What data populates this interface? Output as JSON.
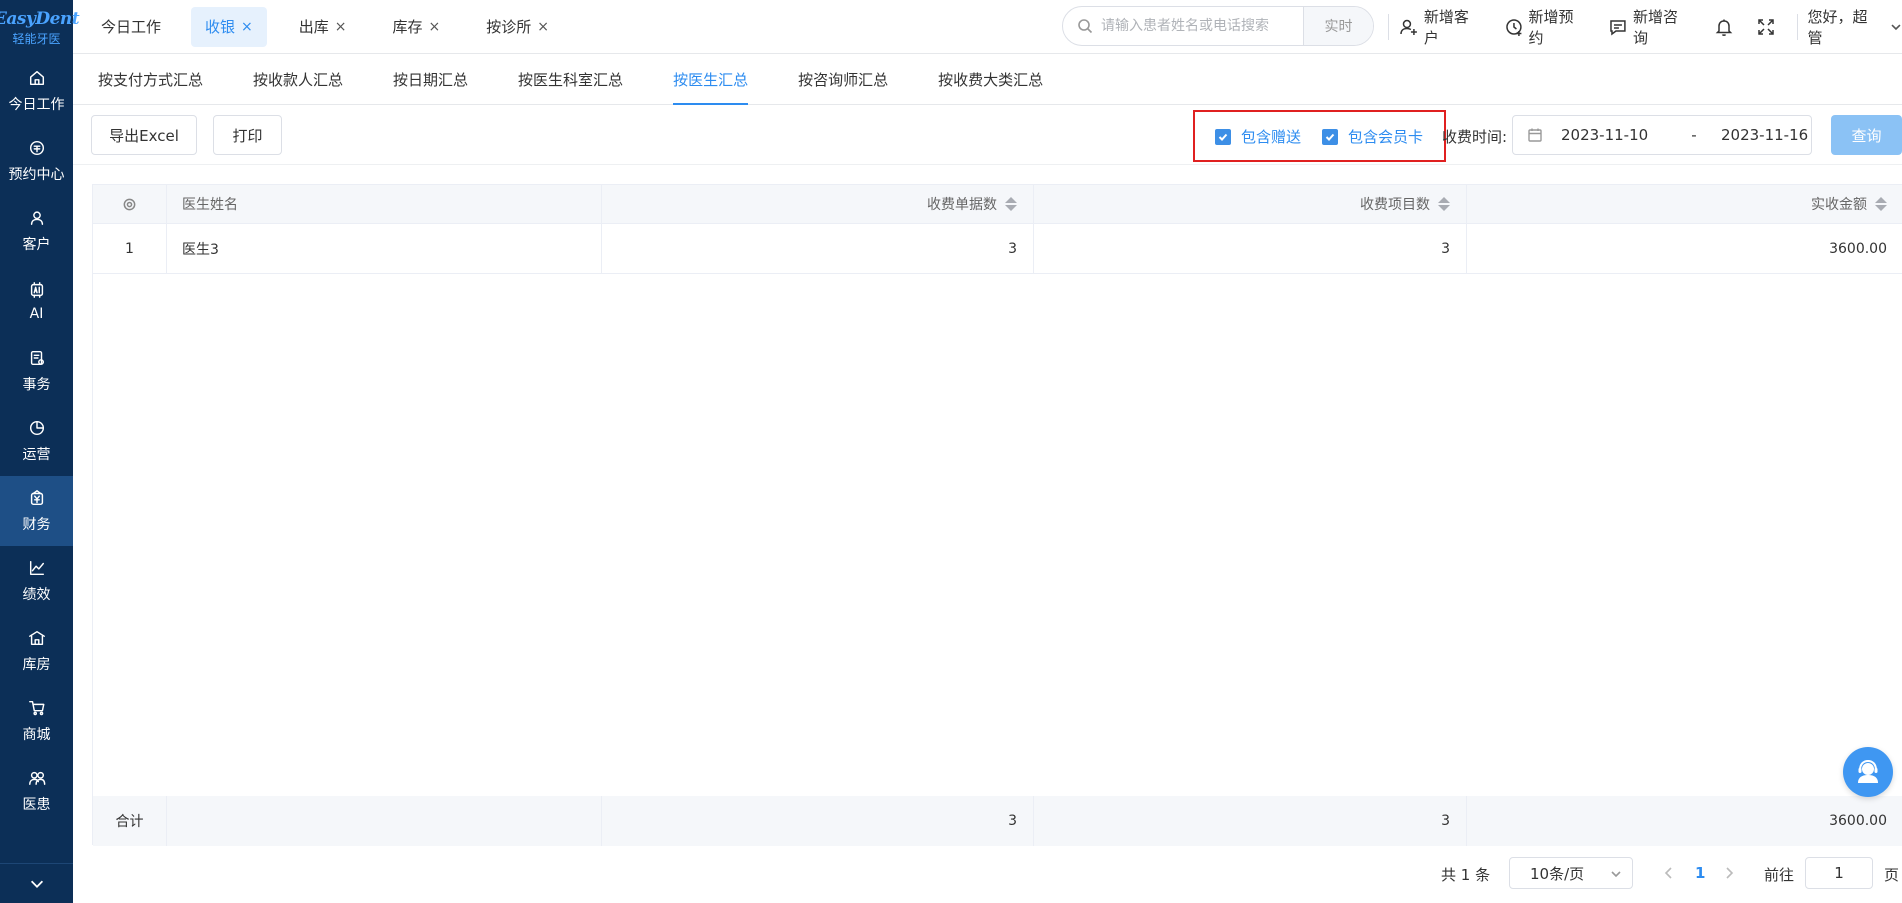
{
  "brand": {
    "logo_en": "EasyDent",
    "logo_cn": "轻能牙医"
  },
  "sidebar": {
    "items": [
      {
        "label": "今日工作",
        "icon": "home-icon"
      },
      {
        "label": "预约中心",
        "icon": "appointment-icon"
      },
      {
        "label": "客户",
        "icon": "customer-icon"
      },
      {
        "label": "AI",
        "icon": "ai-icon"
      },
      {
        "label": "事务",
        "icon": "task-icon"
      },
      {
        "label": "运营",
        "icon": "pie-chart-icon"
      },
      {
        "label": "财务",
        "icon": "finance-icon",
        "active": true
      },
      {
        "label": "绩效",
        "icon": "line-chart-icon"
      },
      {
        "label": "库房",
        "icon": "warehouse-icon"
      },
      {
        "label": "商城",
        "icon": "cart-icon"
      },
      {
        "label": "医患",
        "icon": "doctor-patient-icon"
      }
    ]
  },
  "top_tabs": [
    {
      "label": "今日工作",
      "closable": false
    },
    {
      "label": "收银",
      "closable": true,
      "active": true
    },
    {
      "label": "出库",
      "closable": true
    },
    {
      "label": "库存",
      "closable": true
    },
    {
      "label": "按诊所",
      "closable": true
    }
  ],
  "close_glyph": "×",
  "search": {
    "placeholder": "请输入患者姓名或电话搜索",
    "button": "实时"
  },
  "top_actions": {
    "new_customer": "新增客户",
    "new_appointment": "新增预约",
    "new_consult": "新增咨询",
    "greeting": "您好，超管"
  },
  "sub_tabs": [
    {
      "label": "按支付方式汇总"
    },
    {
      "label": "按收款人汇总"
    },
    {
      "label": "按日期汇总"
    },
    {
      "label": "按医生科室汇总"
    },
    {
      "label": "按医生汇总",
      "active": true
    },
    {
      "label": "按咨询师汇总"
    },
    {
      "label": "按收费大类汇总"
    }
  ],
  "toolbar": {
    "export": "导出Excel",
    "print": "打印",
    "include_gift": "包含赠送",
    "include_member_card": "包含会员卡",
    "date_label": "收费时间:",
    "date_start": "2023-11-10",
    "date_sep": "-",
    "date_end": "2023-11-16",
    "query": "查询"
  },
  "table": {
    "headers": {
      "name": "医生姓名",
      "bills": "收费单据数",
      "items": "收费项目数",
      "amount": "实收金额"
    },
    "rows": [
      {
        "index": "1",
        "name": "医生3",
        "bills": "3",
        "items": "3",
        "amount": "3600.00"
      }
    ],
    "footer": {
      "label": "合计",
      "bills": "3",
      "items": "3",
      "amount": "3600.00"
    }
  },
  "pagination": {
    "total": "共 1 条",
    "page_size": "10条/页",
    "current": "1",
    "goto_label": "前往",
    "goto_value": "1",
    "page_suffix": "页"
  }
}
